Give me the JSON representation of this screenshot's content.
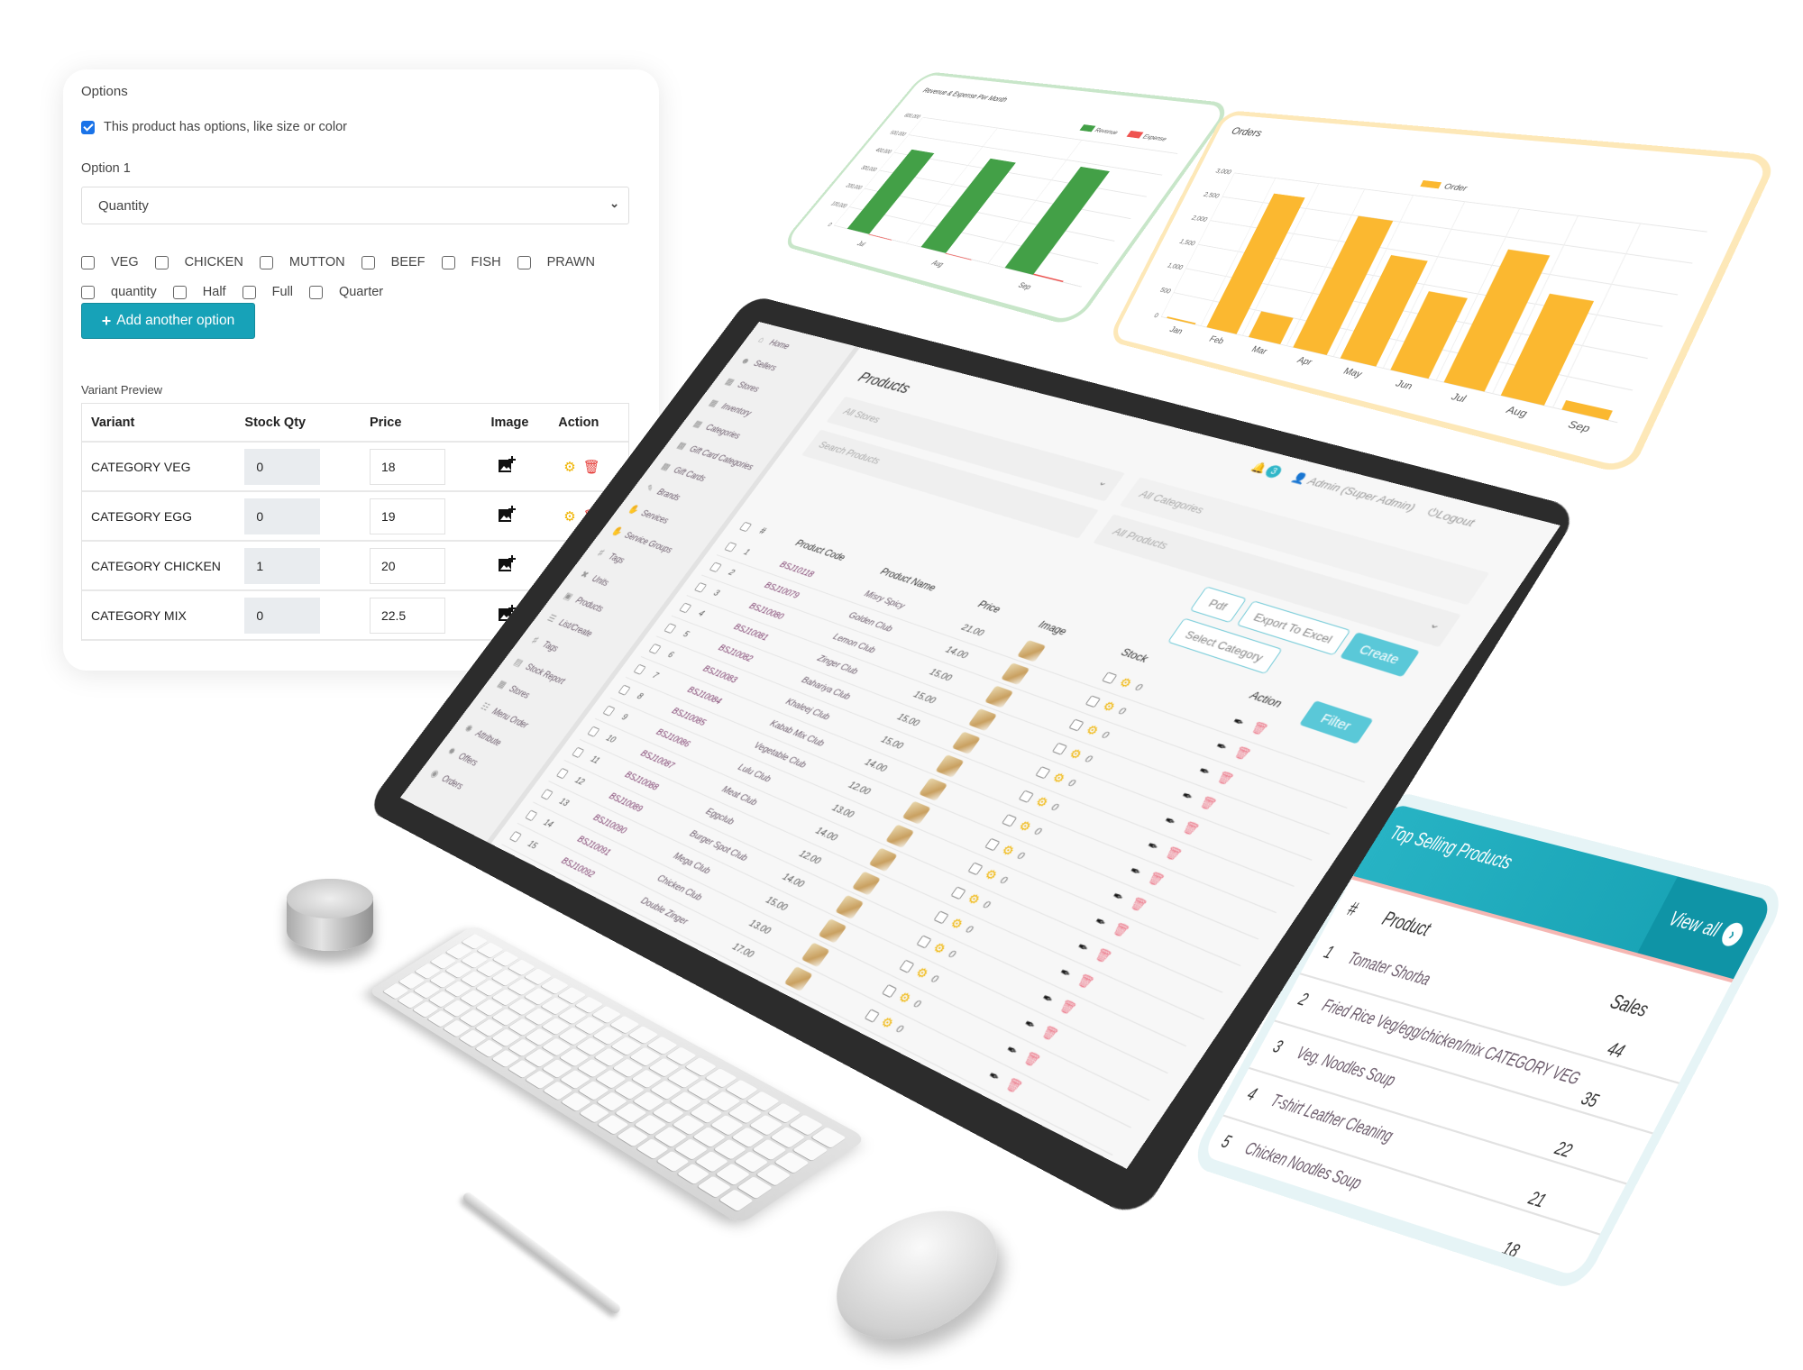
{
  "options_panel": {
    "title": "Options",
    "has_options_label": "This product has options, like size or color",
    "has_options_checked": true,
    "option1_label": "Option 1",
    "option1_value": "Quantity",
    "choices_row1": [
      "VEG",
      "CHICKEN",
      "MUTTON",
      "BEEF",
      "FISH",
      "PRAWN"
    ],
    "choices_row2": [
      "quantity",
      "Half",
      "Full",
      "Quarter"
    ],
    "add_button": "Add another option",
    "variant_preview_label": "Variant Preview",
    "table_headers": [
      "Variant",
      "Stock Qty",
      "Price",
      "Image",
      "Action"
    ],
    "variants": [
      {
        "name": "CATEGORY VEG",
        "stock": "0",
        "price": "18"
      },
      {
        "name": "CATEGORY EGG",
        "stock": "0",
        "price": "19"
      },
      {
        "name": "CATEGORY CHICKEN",
        "stock": "1",
        "price": "20"
      },
      {
        "name": "CATEGORY MIX",
        "stock": "0",
        "price": "22.5"
      }
    ],
    "colors": {
      "button": "#17a2b8",
      "gear": "#f0b400",
      "trash": "#e53935"
    }
  },
  "chart_data": [
    {
      "type": "bar",
      "title": "Revenue & Expense Per Month",
      "categories": [
        "Jul",
        "Aug",
        "Sep"
      ],
      "series": [
        {
          "name": "Revenue",
          "color": "#43a047",
          "values": [
            430000,
            450000,
            480000
          ]
        },
        {
          "name": "Expense",
          "color": "#ef5350",
          "values": [
            0,
            0,
            5000
          ]
        }
      ],
      "yticks": [
        "0",
        "100,000",
        "200,000",
        "300,000",
        "400,000",
        "500,000",
        "600,000"
      ],
      "ylim": [
        0,
        600000
      ],
      "grid": true,
      "legend": "top-right",
      "border_color": "#c8e6c9"
    },
    {
      "type": "bar",
      "title": "Orders",
      "categories": [
        "Jan",
        "Feb",
        "Mar",
        "Apr",
        "May",
        "Jun",
        "Jul",
        "Aug",
        "Sep"
      ],
      "series": [
        {
          "name": "Order",
          "color": "#fbb830",
          "values": [
            30,
            2700,
            500,
            2500,
            1900,
            1400,
            2300,
            1700,
            150
          ]
        }
      ],
      "yticks": [
        "0",
        "500",
        "1,000",
        "1,500",
        "2,000",
        "2,500",
        "3,000"
      ],
      "ylim": [
        0,
        3000
      ],
      "grid": true,
      "legend": "top-center",
      "border_color": "#fde8b8"
    }
  ],
  "admin_app": {
    "sidebar": [
      {
        "label": "Home",
        "icon": "home-icon"
      },
      {
        "label": "Sellers",
        "icon": "users-icon"
      },
      {
        "label": "Stores",
        "icon": "store-icon"
      },
      {
        "label": "Inventory",
        "icon": "grid-icon"
      },
      {
        "label": "Categories",
        "icon": "grid-icon"
      },
      {
        "label": "Gift Card Categories",
        "icon": "gift-icon"
      },
      {
        "label": "Gift Cards",
        "icon": "gift-icon"
      },
      {
        "label": "Brands",
        "icon": "pen-icon"
      },
      {
        "label": "Services",
        "icon": "hand-icon"
      },
      {
        "label": "Service Groups",
        "icon": "hand-icon"
      },
      {
        "label": "Tags",
        "icon": "tag-icon"
      },
      {
        "label": "Units",
        "icon": "tools-icon"
      },
      {
        "label": "Products",
        "icon": "box-icon"
      },
      {
        "label": "List/Create",
        "icon": "list-icon"
      },
      {
        "label": "Tags",
        "icon": "tag-icon"
      },
      {
        "label": "Stock Report",
        "icon": "report-icon"
      },
      {
        "label": "Stores",
        "icon": "store-icon"
      },
      {
        "label": "Menu Order",
        "icon": "menu-icon"
      },
      {
        "label": "Attribute",
        "icon": "attribute-icon"
      },
      {
        "label": "Offers",
        "icon": "badge-icon"
      },
      {
        "label": "Orders",
        "icon": "bag-icon"
      }
    ],
    "page_title": "Products",
    "notification_count": "3",
    "user_label": "Admin (Super Admin)",
    "logout_label": "Logout",
    "filters": {
      "stores": "All Stores",
      "search_placeholder": "Search Products",
      "categories": "All Categories",
      "products": "All Products"
    },
    "buttons": {
      "pdf": "Pdf",
      "export": "Export To Excel",
      "create": "Create",
      "select_category": "Select Category",
      "filter": "Filter"
    },
    "table_headers": [
      "#",
      "Product Code",
      "Product Name",
      "Price",
      "Image",
      "Stock",
      "Action"
    ],
    "products": [
      {
        "n": "1",
        "code": "BSJ10118",
        "name": "Misry Spicy",
        "price": "21.00",
        "stock": "0"
      },
      {
        "n": "2",
        "code": "BSJ10079",
        "name": "Golden Club",
        "price": "14.00",
        "stock": "0"
      },
      {
        "n": "3",
        "code": "BSJ10080",
        "name": "Lemon Club",
        "price": "15.00",
        "stock": "0"
      },
      {
        "n": "4",
        "code": "BSJ10081",
        "name": "Zinger Club",
        "price": "15.00",
        "stock": "0"
      },
      {
        "n": "5",
        "code": "BSJ10082",
        "name": "Bahariya Club",
        "price": "15.00",
        "stock": "0"
      },
      {
        "n": "6",
        "code": "BSJ10083",
        "name": "Khaleej Club",
        "price": "15.00",
        "stock": "0"
      },
      {
        "n": "7",
        "code": "BSJ10084",
        "name": "Kabab Mix Club",
        "price": "14.00",
        "stock": "0"
      },
      {
        "n": "8",
        "code": "BSJ10085",
        "name": "Vegetable Club",
        "price": "12.00",
        "stock": "0"
      },
      {
        "n": "9",
        "code": "BSJ10086",
        "name": "Lulu Club",
        "price": "13.00",
        "stock": "0"
      },
      {
        "n": "10",
        "code": "BSJ10087",
        "name": "Meat Club",
        "price": "14.00",
        "stock": "0"
      },
      {
        "n": "11",
        "code": "BSJ10088",
        "name": "Eggclub",
        "price": "12.00",
        "stock": "0"
      },
      {
        "n": "12",
        "code": "BSJ10089",
        "name": "Burger Spot Club",
        "price": "14.00",
        "stock": "0"
      },
      {
        "n": "13",
        "code": "BSJ10090",
        "name": "Mega Club",
        "price": "15.00",
        "stock": "0"
      },
      {
        "n": "14",
        "code": "BSJ10091",
        "name": "Chicken Club",
        "price": "13.00",
        "stock": "0"
      },
      {
        "n": "15",
        "code": "BSJ10092",
        "name": "Double Zinger",
        "price": "17.00",
        "stock": "0"
      }
    ],
    "accent": "#5ac8d8"
  },
  "top_selling": {
    "title": "Top Selling Products",
    "view_all": "View all",
    "headers": [
      "#",
      "Product",
      "Sales"
    ],
    "rows": [
      {
        "n": "1",
        "product": "Tomater Shorba",
        "sales": "44"
      },
      {
        "n": "2",
        "product": "Fried Rice Veg/egg/chicken/mix CATEGORY VEG",
        "sales": "35"
      },
      {
        "n": "3",
        "product": "Veg. Noodles Soup",
        "sales": "22"
      },
      {
        "n": "4",
        "product": "T-shirt Leather Cleaning",
        "sales": "21"
      },
      {
        "n": "5",
        "product": "Chicken Noodles Soup",
        "sales": "18"
      }
    ],
    "header_color": "#1fa9ba"
  }
}
